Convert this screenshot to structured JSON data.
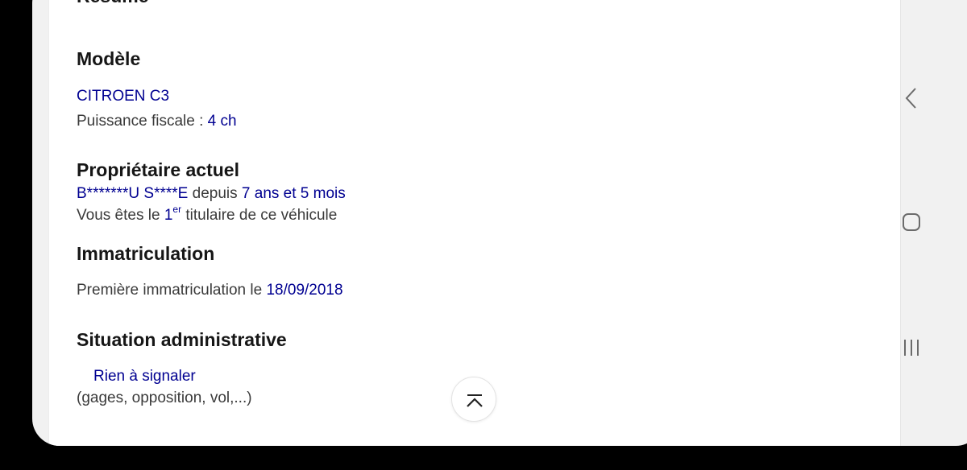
{
  "summary_heading": "Résumé",
  "model": {
    "heading": "Modèle",
    "name": "CITROEN C3",
    "fiscal_power_label": "Puissance fiscale :",
    "fiscal_power_value": "4 ch"
  },
  "owner": {
    "heading": "Propriétaire actuel",
    "name": "B*******U S****E",
    "since_label": "depuis",
    "duration": "7 ans et 5 mois",
    "status_prefix": "Vous êtes le",
    "rank": "1",
    "rank_suffix": "er",
    "status_suffix": "titulaire de ce véhicule"
  },
  "registration": {
    "heading": "Immatriculation",
    "first_label": "Première immatriculation le",
    "first_date": "18/09/2018"
  },
  "admin": {
    "heading": "Situation administrative",
    "status": "Rien à signaler",
    "details": "(gages, opposition, vol,...)"
  },
  "icons": {
    "scroll_top": "chevron-up-bar-icon",
    "nav_back": "chevron-left-icon",
    "nav_home": "rounded-square-icon",
    "nav_recents": "three-bars-icon"
  },
  "colors": {
    "link_blue": "#000091",
    "heading_text": "#161616",
    "body_text": "#3a3a3a"
  }
}
